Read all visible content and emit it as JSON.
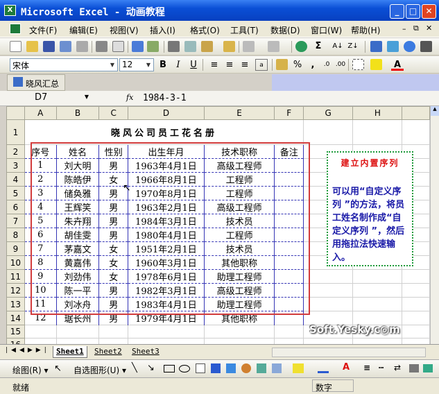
{
  "window": {
    "title": "Microsoft Excel - 动画教程"
  },
  "menu": [
    "文件(F)",
    "编辑(E)",
    "视图(V)",
    "插入(I)",
    "格式(O)",
    "工具(T)",
    "数据(D)",
    "窗口(W)",
    "帮助(H)"
  ],
  "format_toolbar": {
    "font": "宋体",
    "size": "12"
  },
  "custom_toolbar": {
    "button_label": "晓风汇总"
  },
  "formula_bar": {
    "name_box": "D7",
    "fx": "fx",
    "value": "1984-3-1"
  },
  "columns": [
    "A",
    "B",
    "C",
    "D",
    "E",
    "F",
    "G",
    "H"
  ],
  "rows": [
    "1",
    "2",
    "3",
    "4",
    "5",
    "6",
    "7",
    "8",
    "9",
    "10",
    "11",
    "12",
    "13",
    "14",
    "15",
    "16"
  ],
  "sheet": {
    "title": "晓风公司员工花名册",
    "headers": [
      "序号",
      "姓名",
      "性别",
      "出生年月",
      "技术职称",
      "备注"
    ],
    "records": [
      [
        "1",
        "刘大明",
        "男",
        "1963年4月1日",
        "高级工程师",
        ""
      ],
      [
        "2",
        "陈皓伊",
        "女",
        "1966年8月1日",
        "工程师",
        ""
      ],
      [
        "3",
        "储奂雅",
        "男",
        "1970年8月1日",
        "工程师",
        ""
      ],
      [
        "4",
        "王辉笑",
        "男",
        "1963年2月1日",
        "高级工程师",
        ""
      ],
      [
        "5",
        "朱卉翔",
        "男",
        "1984年3月1日",
        "技术员",
        ""
      ],
      [
        "6",
        "胡佳雯",
        "男",
        "1980年4月1日",
        "工程师",
        ""
      ],
      [
        "7",
        "茅嘉文",
        "女",
        "1951年2月1日",
        "技术员",
        ""
      ],
      [
        "8",
        "黄嘉伟",
        "女",
        "1960年3月1日",
        "其他职称",
        ""
      ],
      [
        "9",
        "刘劲伟",
        "女",
        "1978年6月1日",
        "助理工程师",
        ""
      ],
      [
        "10",
        "陈一平",
        "男",
        "1982年3月1日",
        "高级工程师",
        ""
      ],
      [
        "11",
        "刘冰舟",
        "男",
        "1983年4月1日",
        "助理工程师",
        ""
      ],
      [
        "12",
        "琚长州",
        "男",
        "1979年4月1日",
        "其他职称",
        ""
      ]
    ]
  },
  "note": {
    "heading": "建立内置序列",
    "body": "可以用“自定义序列 ”的方法，将员工姓名制作成“自定义序列 ”，然后用拖拉法快速输入。"
  },
  "watermark": "Soft.Yesky.c◎m",
  "sheet_tabs": [
    "Sheet1",
    "Sheet2",
    "Sheet3"
  ],
  "draw_toolbar": {
    "draw_label": "绘图(R) ▾",
    "autoshapes_label": "自选图形(U) ▾"
  },
  "status": {
    "left": "就绪",
    "right": "数字"
  }
}
